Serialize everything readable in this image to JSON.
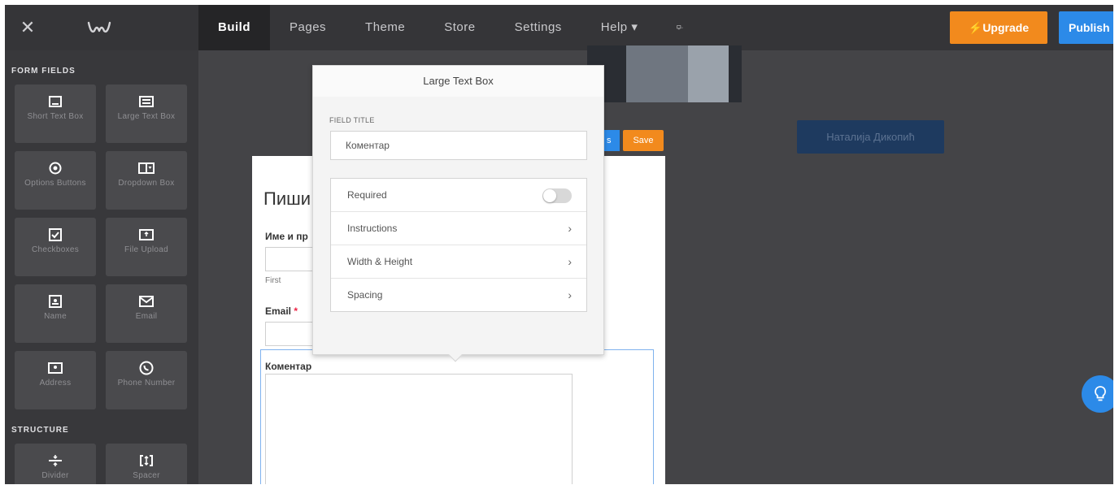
{
  "topbar": {
    "nav": [
      "Build",
      "Pages",
      "Theme",
      "Store",
      "Settings",
      "Help ▾"
    ],
    "upgrade_label": "Upgrade",
    "publish_label": "Publish"
  },
  "sidebar": {
    "form_fields_title": "FORM FIELDS",
    "structure_title": "STRUCTURE",
    "tiles": [
      {
        "label": "Short Text Box",
        "icon": "short-text-icon"
      },
      {
        "label": "Large Text Box",
        "icon": "large-text-icon"
      },
      {
        "label": "Options Buttons",
        "icon": "radio-icon"
      },
      {
        "label": "Dropdown Box",
        "icon": "dropdown-icon"
      },
      {
        "label": "Checkboxes",
        "icon": "checkbox-icon"
      },
      {
        "label": "File Upload",
        "icon": "upload-icon"
      },
      {
        "label": "Name",
        "icon": "name-icon"
      },
      {
        "label": "Email",
        "icon": "envelope-icon"
      },
      {
        "label": "Address",
        "icon": "address-icon"
      },
      {
        "label": "Phone Number",
        "icon": "phone-icon"
      }
    ],
    "structure_tiles": [
      {
        "label": "Divider",
        "icon": "divider-icon"
      },
      {
        "label": "Spacer",
        "icon": "spacer-icon"
      }
    ]
  },
  "canvas": {
    "name_button": "Наталија Дикопић",
    "mini_button": "s",
    "save_label": "Save",
    "form": {
      "heading": "Пиши",
      "name_label": "Име и пр",
      "first_sub": "First",
      "email_label": "Email",
      "required_mark": "*",
      "comment_label": "Коментар"
    }
  },
  "popup": {
    "title": "Large Text Box",
    "field_title_label": "FIELD TITLE",
    "field_title_value": "Коментар",
    "rows": {
      "required": "Required",
      "instructions": "Instructions",
      "width_height": "Width & Height",
      "spacing": "Spacing"
    },
    "required_on": false
  },
  "colors": {
    "accent_orange": "#f28a1d",
    "accent_blue": "#2c8ae8",
    "editor_bg": "#444447"
  }
}
